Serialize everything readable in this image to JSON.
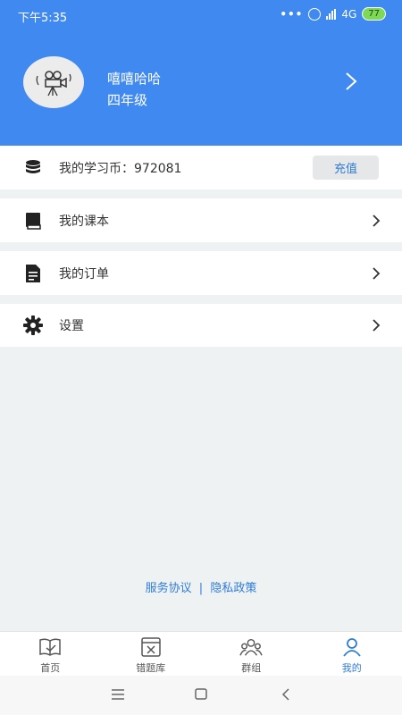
{
  "status_bar": {
    "time": "下午5:35",
    "network": "4G",
    "battery": "77",
    "dots": "•••"
  },
  "profile": {
    "username": "嘻嘻哈哈",
    "grade": "四年级"
  },
  "coins": {
    "label": "我的学习币：972081",
    "recharge_label": "充值"
  },
  "menu": {
    "books_label": "我的课本",
    "orders_label": "我的订单",
    "settings_label": "设置"
  },
  "footer": {
    "service_agreement": "服务协议",
    "separator": "|",
    "privacy_policy": "隐私政策"
  },
  "tabs": [
    {
      "label": "首页",
      "icon": "book-open-icon",
      "active": false
    },
    {
      "label": "错题库",
      "icon": "error-box-icon",
      "active": false
    },
    {
      "label": "群组",
      "icon": "group-icon",
      "active": false
    },
    {
      "label": "我的",
      "icon": "user-icon",
      "active": true
    }
  ],
  "colors": {
    "header_blue": "#3f89f1",
    "link_blue": "#2f7cd8",
    "background": "#eff2f3"
  }
}
